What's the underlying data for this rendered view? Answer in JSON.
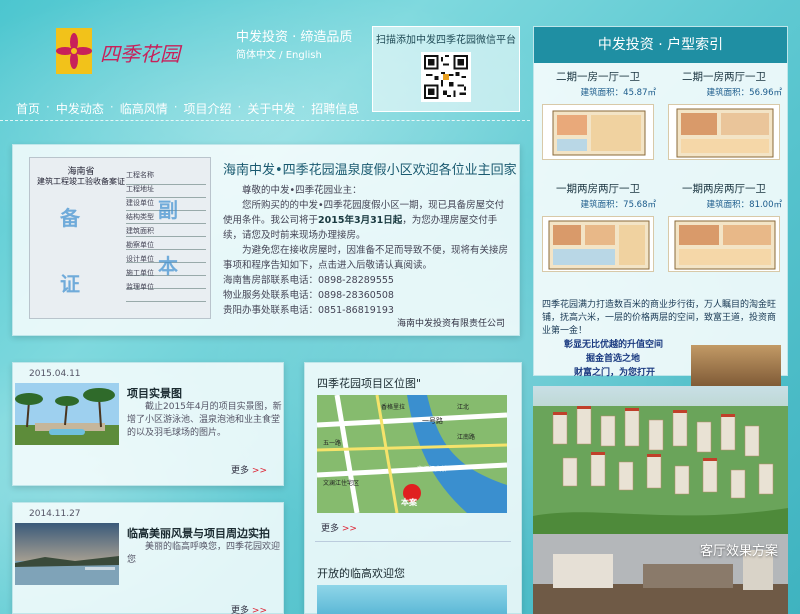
{
  "header": {
    "logo_text": "四季花园",
    "slogan": "中发投资 · 缔造品质",
    "lang_cn": "简体中文",
    "lang_sep": " / ",
    "lang_en": "English",
    "qr_caption": "扫描添加中发四季花园微信平台"
  },
  "nav": {
    "items": [
      "首页",
      "中发动态",
      "临高风情",
      "项目介绍",
      "关于中发",
      "招聘信息"
    ],
    "separator": "·"
  },
  "notice": {
    "title": "海南中发•四季花园温泉度假小区欢迎各位业主回家",
    "cert_title": "海南省",
    "cert_subtitle": "建筑工程竣工验收备案证",
    "cert_marks": [
      "备",
      "副",
      "本",
      "证"
    ],
    "cert_row_labels": [
      "工程名称",
      "工程地址",
      "建设单位",
      "结构类型",
      "建筑面积",
      "勘察单位",
      "设计单位",
      "施工单位",
      "监理单位"
    ],
    "greeting": "尊敬的中发•四季花园业主：",
    "para1_a": "您所购买的的中发•四季花园度假小区一期，现已具备房屋交付使用条件。我公司将于",
    "para1_date": "2015年3月31日起",
    "para1_b": "，为您办理房屋交付手续，请您及时前来现场办理接房。",
    "para2": "为避免您在接收房屋时，因准备不足而导致不便，现将有关接房事项和程序告知如下，点击进入后敬请认真阅读。",
    "phone1": "海南售房部联系电话：0898-28289555",
    "phone2": "物业服务处联系电话：0898-28360508",
    "phone3": "贵阳办事处联系电话：0851-86819193",
    "signature": "海南中发投资有限责任公司"
  },
  "news": [
    {
      "date": "2015.04.11",
      "title": "项目实景图",
      "text": "截止2015年4月的项目实景图，新增了小区游泳池、温泉泡池和业主食堂的以及羽毛球场的图片。",
      "more": "更多 ",
      "arrow": ">>"
    },
    {
      "date": "2014.11.27",
      "title": "临高美丽风景与项目周边实拍",
      "text": "美丽的临高呼唤您，四季花园欢迎您",
      "more": "更多 ",
      "arrow": ">>"
    }
  ],
  "map_card": {
    "title": "四季花园项目区位图\"",
    "map_labels": [
      "一号路",
      "文澜江住宅区",
      "文澜江大桥",
      "本案",
      "五一路",
      "江南路",
      "江北",
      "香格里拉"
    ],
    "more": "更多 ",
    "arrow": ">>",
    "title2": "开放的临高欢迎您"
  },
  "units": {
    "header": "中发投资 · 户型索引",
    "items": [
      {
        "name": "二期一房一厅一卫",
        "area": "建筑面积：45.87㎡"
      },
      {
        "name": "二期一房两厅一卫",
        "area": "建筑面积：56.96㎡"
      },
      {
        "name": "一期两房两厅一卫",
        "area": "建筑面积：75.68㎡"
      },
      {
        "name": "一期两房两厅一卫",
        "area": "建筑面积：81.00㎡"
      }
    ]
  },
  "promo": {
    "line1": "四季花园满力打造数百米的商业步行街，万人瞩目的淘金旺铺，抚高六米，一层的价格两层的空间，致富王道，投资商业第一金！",
    "line2": "彰显无比优越的升值空间",
    "line3": "掘金首选之地",
    "line4": "财富之门，为您打开"
  },
  "living": {
    "label": "客厅效果方案"
  }
}
